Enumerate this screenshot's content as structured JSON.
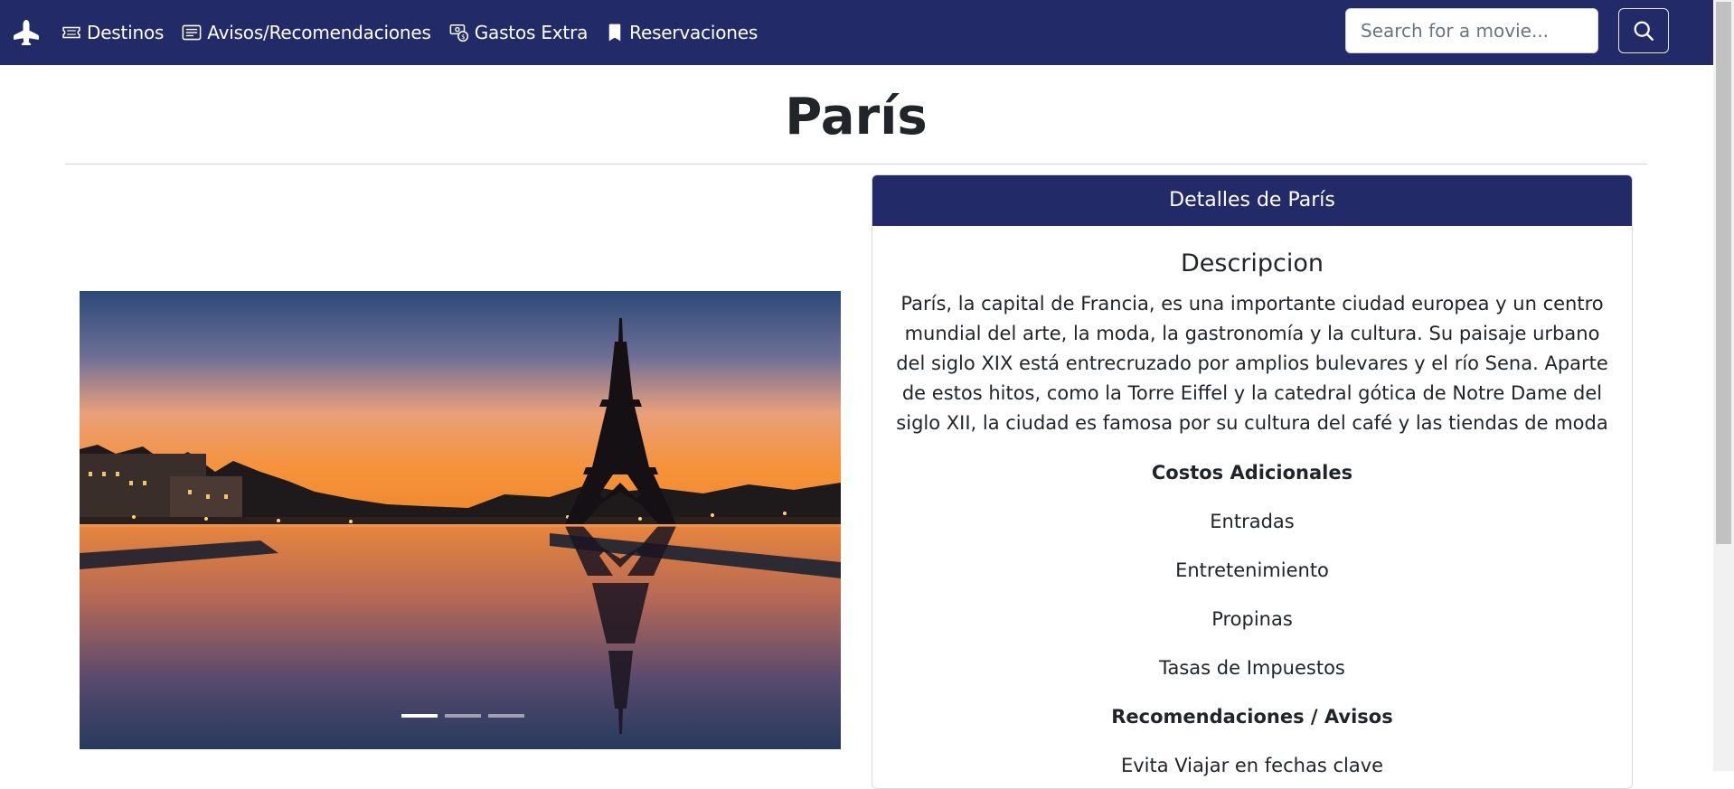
{
  "navbar": {
    "brand_icon": "airplane-icon",
    "items": [
      {
        "label": "Destinos",
        "icon": "ticket-icon"
      },
      {
        "label": "Avisos/Recomendaciones",
        "icon": "card-text-icon"
      },
      {
        "label": "Gastos Extra",
        "icon": "cash-coin-icon"
      },
      {
        "label": "Reservaciones",
        "icon": "bookmark-icon"
      }
    ],
    "search": {
      "placeholder": "Search for a movie...",
      "value": "",
      "button_icon": "search-icon"
    }
  },
  "page": {
    "title": "París"
  },
  "carousel": {
    "slide_count": 3,
    "active_slide": 1,
    "image": "Eiffel Tower reflected in the Seine at sunset"
  },
  "details": {
    "header": "Detalles de París",
    "description_title": "Descripcion",
    "description": "París, la capital de Francia, es una importante ciudad europea y un centro mundial del arte, la moda, la gastronomía y la cultura. Su paisaje urbano del siglo XIX está entrecruzado por amplios bulevares y el río Sena. Aparte de estos hitos, como la Torre Eiffel y la catedral gótica de Notre Dame del siglo XII, la ciudad es famosa por su cultura del café y las tiendas de moda de diseñador a lo largo de la calle Rue du",
    "costs_title": "Costos Adicionales",
    "costs": [
      "Entradas",
      "Entretenimiento",
      "Propinas",
      "Tasas de Impuestos"
    ],
    "recommendations_title": "Recomendaciones / Avisos",
    "recommendations": [
      "Evita Viajar en fechas clave"
    ]
  },
  "colors": {
    "navbar": "#222b68",
    "card_header": "#222b68"
  }
}
